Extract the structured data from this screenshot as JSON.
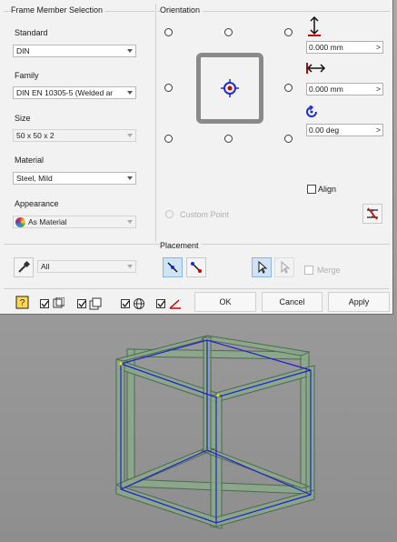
{
  "frame_member": {
    "title": "Frame Member Selection",
    "standard": {
      "label": "Standard",
      "value": "DIN"
    },
    "family": {
      "label": "Family",
      "value": "DIN EN 10305-5 (Welded ar"
    },
    "size": {
      "label": "Size",
      "value": "50 x 50 x 2"
    },
    "material": {
      "label": "Material",
      "value": "Steel, Mild"
    },
    "appearance": {
      "label": "Appearance",
      "value": "As Material"
    }
  },
  "orientation": {
    "title": "Orientation",
    "offset_vertical": "0.000 mm",
    "offset_horizontal": "0.000 mm",
    "rotation": "0.00 deg",
    "custom_point": "Custom Point",
    "align": "Align"
  },
  "placement": {
    "title": "Placement",
    "filter_value": "All",
    "merge": "Merge"
  },
  "footer": {
    "ok": "OK",
    "cancel": "Cancel",
    "apply": "Apply"
  },
  "colors": {
    "frame_green": "#7f9f7f",
    "edge_blue": "#2020d0",
    "accent_red": "#d00000",
    "pressed_blue": "#cfe3f7"
  }
}
